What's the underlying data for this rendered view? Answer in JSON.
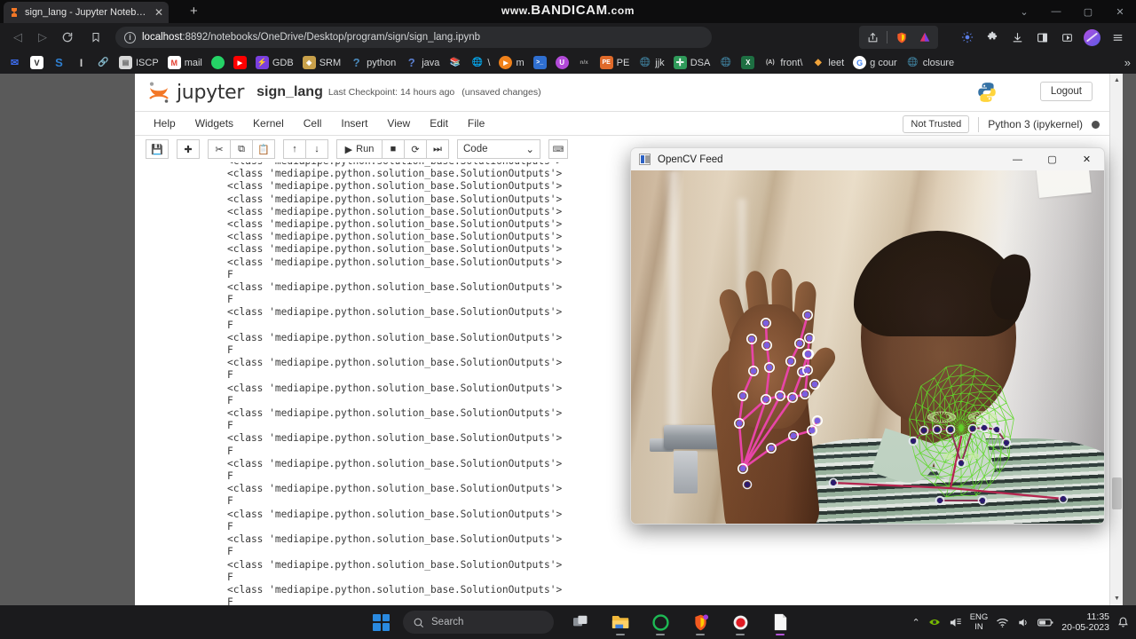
{
  "browser": {
    "tab": {
      "title": "sign_lang - Jupyter Notebook",
      "favicon": "jupyter-icon",
      "close": "✕"
    },
    "new_tab": "+",
    "watermark_prefix": "www.",
    "watermark_main": "BANDICAM",
    "watermark_suffix": ".com",
    "window_controls": {
      "restore_down": "⌄",
      "minimize": "—",
      "maximize": "▢",
      "close": "✕"
    },
    "nav": {
      "back": "◁",
      "forward": "▷",
      "reload": "⟳",
      "bookmark": "🔖"
    },
    "url": {
      "host": "localhost",
      "rest": ":8892/notebooks/OneDrive/Desktop/program/sign/sign_lang.ipynb",
      "security": "i"
    },
    "toolbar_icons": [
      "share-icon",
      "brave-shield-icon",
      "triangle-ext-icon",
      "gear-ext-icon",
      "puzzle-extensions-icon",
      "download-icon",
      "sidebar-icon",
      "cast-icon",
      "profile-avatar",
      "menu-icon"
    ],
    "bookmarks": [
      {
        "label": "",
        "icon": "mail-blue-icon",
        "color": "#2a55d8"
      },
      {
        "label": "",
        "icon": "v-letter-icon",
        "color": "#ffffff"
      },
      {
        "label": "",
        "icon": "s-letter-icon",
        "color": "#2f7fd0"
      },
      {
        "label": "",
        "icon": "i-letter-icon",
        "color": "#cfcfcf"
      },
      {
        "label": "",
        "icon": "link-teal-icon",
        "color": "#17a2b8"
      },
      {
        "label": "ISCP",
        "icon": "page-icon",
        "color": "#d8d8d8"
      },
      {
        "label": "mail",
        "icon": "gmail-icon",
        "color": "#e34133"
      },
      {
        "label": "",
        "icon": "whatsapp-icon",
        "color": "#25d366"
      },
      {
        "label": "",
        "icon": "youtube-icon",
        "color": "#ff0000"
      },
      {
        "label": "GDB",
        "icon": "bolt-icon",
        "color": "#7a3fe0"
      },
      {
        "label": "SRM",
        "icon": "srm-icon",
        "color": "#c8a04a"
      },
      {
        "label": "python",
        "icon": "question-icon",
        "color": "#4b8bbe"
      },
      {
        "label": "java",
        "icon": "question-icon",
        "color": "#5b7fd0"
      },
      {
        "label": "",
        "icon": "books-icon",
        "color": "#e05a4a"
      },
      {
        "label": "\\",
        "icon": "globe-icon",
        "color": "#1da1a6"
      },
      {
        "label": "m",
        "icon": "play-orange-icon",
        "color": "#f0811a"
      },
      {
        "label": "",
        "icon": "terminal-icon",
        "color": "#2f6fd0"
      },
      {
        "label": "",
        "icon": "u-circle-icon",
        "color": "#b24ad8"
      },
      {
        "label": "",
        "icon": "nx-icon",
        "color": "#7a7a7a"
      },
      {
        "label": "PE",
        "icon": "pe-icon",
        "color": "#e06a2a"
      },
      {
        "label": "jjk",
        "icon": "globe-dim-icon",
        "color": "#4b9a6a"
      },
      {
        "label": "DSA",
        "icon": "plus-green-icon",
        "color": "#2f9a5a"
      },
      {
        "label": "",
        "icon": "globe-dim-icon",
        "color": "#4b9a6a"
      },
      {
        "label": "",
        "icon": "excel-icon",
        "color": "#1e6f42"
      },
      {
        "label": "front\\",
        "icon": "a-paren-icon",
        "color": "#d0d0d0"
      },
      {
        "label": "leet",
        "icon": "leetcode-icon",
        "color": "#f0a33a"
      },
      {
        "label": "g cour",
        "icon": "google-icon",
        "color": "#4285f4"
      },
      {
        "label": "closure",
        "icon": "globe-dim-icon",
        "color": "#4b9a6a"
      }
    ],
    "bookmarks_overflow": "»"
  },
  "jupyter": {
    "brand": "jupyter",
    "notebook_name": "sign_lang",
    "checkpoint": "Last Checkpoint: 14 hours ago",
    "unsaved": "(unsaved changes)",
    "logout": "Logout",
    "menus": [
      "File",
      "Edit",
      "View",
      "Insert",
      "Cell",
      "Kernel",
      "Widgets",
      "Help"
    ],
    "trust_status": "Not Trusted",
    "kernel_name": "Python 3 (ipykernel)",
    "toolbar": {
      "save": "💾",
      "insert_below": "✚",
      "cut": "✂",
      "copy": "⧉",
      "paste": "📋",
      "move_up": "↑",
      "move_down": "↓",
      "run_icon": "▶",
      "run_label": "Run",
      "interrupt": "■",
      "restart": "⟳",
      "restart_run_all": "⏭",
      "cell_type": "Code",
      "cell_type_caret": "⌄",
      "command_palette": "⌨"
    },
    "output": {
      "class_line": "<class 'mediapipe.python.solution_base.SolutionOutputs'>",
      "f_line": "F",
      "lines": [
        "<class 'mediapipe.python.solution_base.SolutionOutputs'>",
        "<class 'mediapipe.python.solution_base.SolutionOutputs'>",
        "<class 'mediapipe.python.solution_base.SolutionOutputs'>",
        "<class 'mediapipe.python.solution_base.SolutionOutputs'>",
        "<class 'mediapipe.python.solution_base.SolutionOutputs'>",
        "<class 'mediapipe.python.solution_base.SolutionOutputs'>",
        "<class 'mediapipe.python.solution_base.SolutionOutputs'>",
        "<class 'mediapipe.python.solution_base.SolutionOutputs'>",
        "<class 'mediapipe.python.solution_base.SolutionOutputs'>",
        "F",
        "<class 'mediapipe.python.solution_base.SolutionOutputs'>",
        "F",
        "<class 'mediapipe.python.solution_base.SolutionOutputs'>",
        "F",
        "<class 'mediapipe.python.solution_base.SolutionOutputs'>",
        "F",
        "<class 'mediapipe.python.solution_base.SolutionOutputs'>",
        "F",
        "<class 'mediapipe.python.solution_base.SolutionOutputs'>",
        "F",
        "<class 'mediapipe.python.solution_base.SolutionOutputs'>",
        "F",
        "<class 'mediapipe.python.solution_base.SolutionOutputs'>",
        "F",
        "<class 'mediapipe.python.solution_base.SolutionOutputs'>",
        "F",
        "<class 'mediapipe.python.solution_base.SolutionOutputs'>",
        "F",
        "<class 'mediapipe.python.solution_base.SolutionOutputs'>",
        "F",
        "<class 'mediapipe.python.solution_base.SolutionOutputs'>",
        "F",
        "<class 'mediapipe.python.solution_base.SolutionOutputs'>",
        "F",
        "<class 'mediapipe.python.solution_base.SolutionOutputs'>",
        "F"
      ]
    },
    "scroll": {
      "up": "▲",
      "down": "▼"
    }
  },
  "opencv_window": {
    "title": "OpenCV Feed",
    "icon": "opencv-window-icon",
    "controls": {
      "minimize": "—",
      "maximize": "▢",
      "close": "✕"
    },
    "overlay_colors": {
      "hand_connection": "#e845a8",
      "hand_landmark_fill": "#7a5fe0",
      "hand_landmark_ring": "#ffffff",
      "face_mesh": "#5fd92a",
      "pose_connection": "#b5254f",
      "pose_landmark_fill": "#2b1a6e"
    }
  },
  "taskbar": {
    "start": "windows-start-icon",
    "search_placeholder": "Search",
    "apps": [
      "task-view-icon",
      "file-explorer-icon",
      "spotify-icon",
      "brave-browser-icon",
      "bandicam-record-icon",
      "notepad-icon"
    ],
    "tray": {
      "chevron": "⌃",
      "icons": [
        "nvidia-icon",
        "volume-mixer-icon",
        "wifi-icon",
        "speaker-icon",
        "battery-icon",
        "notification-icon"
      ],
      "language_line1": "ENG",
      "language_line2": "IN",
      "time": "11:35",
      "date": "20-05-2023"
    }
  }
}
